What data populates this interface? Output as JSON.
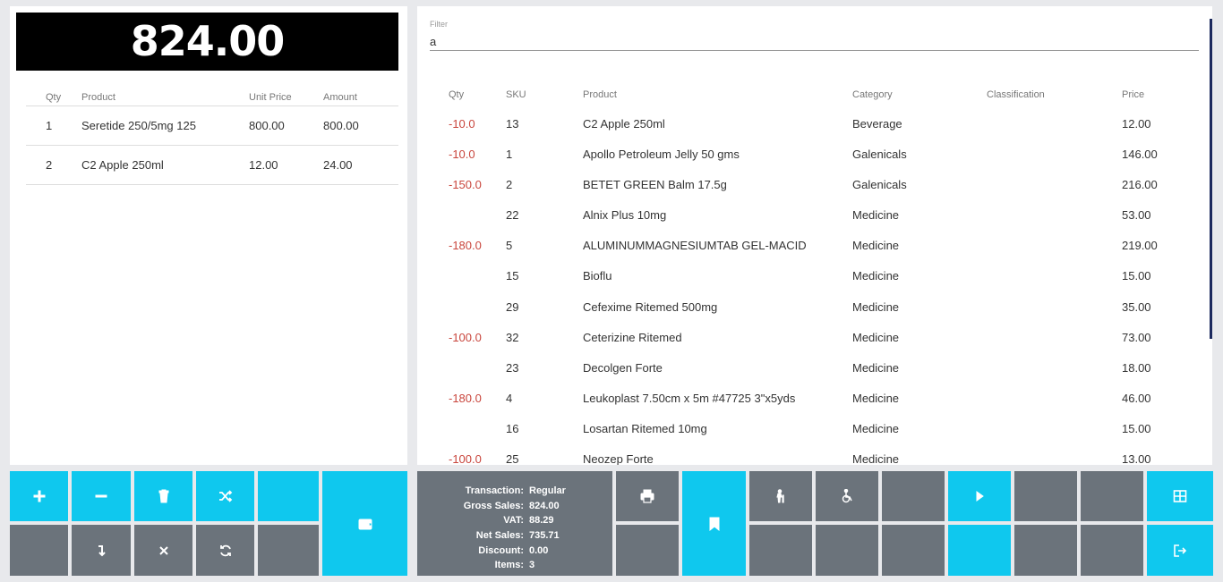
{
  "total_display": "824.00",
  "cart": {
    "headers": {
      "qty": "Qty",
      "product": "Product",
      "unit_price": "Unit Price",
      "amount": "Amount"
    },
    "rows": [
      {
        "qty": "1",
        "product": "Seretide 250/5mg 125",
        "unit_price": "800.00",
        "amount": "800.00"
      },
      {
        "qty": "2",
        "product": "C2 Apple 250ml",
        "unit_price": "12.00",
        "amount": "24.00"
      }
    ]
  },
  "filter": {
    "label": "Filter",
    "value": "a"
  },
  "products": {
    "headers": {
      "qty": "Qty",
      "sku": "SKU",
      "product": "Product",
      "category": "Category",
      "classification": "Classification",
      "price": "Price"
    },
    "rows": [
      {
        "qty": "-10.0",
        "sku": "13",
        "product": "C2 Apple 250ml",
        "category": "Beverage",
        "classification": "",
        "price": "12.00"
      },
      {
        "qty": "-10.0",
        "sku": "1",
        "product": "Apollo Petroleum Jelly 50 gms",
        "category": "Galenicals",
        "classification": "",
        "price": "146.00"
      },
      {
        "qty": "-150.0",
        "sku": "2",
        "product": "BETET GREEN Balm 17.5g",
        "category": "Galenicals",
        "classification": "",
        "price": "216.00"
      },
      {
        "qty": "",
        "sku": "22",
        "product": "Alnix Plus 10mg",
        "category": "Medicine",
        "classification": "",
        "price": "53.00"
      },
      {
        "qty": "-180.0",
        "sku": "5",
        "product": "ALUMINUMMAGNESIUMTAB GEL-MACID",
        "category": "Medicine",
        "classification": "",
        "price": "219.00"
      },
      {
        "qty": "",
        "sku": "15",
        "product": "Bioflu",
        "category": "Medicine",
        "classification": "",
        "price": "15.00"
      },
      {
        "qty": "",
        "sku": "29",
        "product": "Cefexime Ritemed 500mg",
        "category": "Medicine",
        "classification": "",
        "price": "35.00"
      },
      {
        "qty": "-100.0",
        "sku": "32",
        "product": "Ceterizine Ritemed",
        "category": "Medicine",
        "classification": "",
        "price": "73.00"
      },
      {
        "qty": "",
        "sku": "23",
        "product": "Decolgen Forte",
        "category": "Medicine",
        "classification": "",
        "price": "18.00"
      },
      {
        "qty": "-180.0",
        "sku": "4",
        "product": "Leukoplast 7.50cm x 5m #47725 3\"x5yds",
        "category": "Medicine",
        "classification": "",
        "price": "46.00"
      },
      {
        "qty": "",
        "sku": "16",
        "product": "Losartan Ritemed 10mg",
        "category": "Medicine",
        "classification": "",
        "price": "15.00"
      },
      {
        "qty": "-100.0",
        "sku": "25",
        "product": "Neozep Forte",
        "category": "Medicine",
        "classification": "",
        "price": "13.00"
      }
    ]
  },
  "summary": {
    "transaction_label": "Transaction:",
    "transaction": "Regular",
    "gross_label": "Gross Sales:",
    "gross": "824.00",
    "vat_label": "VAT:",
    "vat": "88.29",
    "net_label": "Net Sales:",
    "net": "735.71",
    "discount_label": "Discount:",
    "discount": "0.00",
    "items_label": "Items:",
    "items": "3"
  },
  "icons": {
    "add": "plus-icon",
    "minus": "minus-icon",
    "delete": "trash-icon",
    "shuffle": "shuffle-icon",
    "enter": "level-down-icon",
    "cancel": "close-icon",
    "refresh": "refresh-icon",
    "wallet": "wallet-icon",
    "print": "print-icon",
    "bookmark": "bookmark-icon",
    "senior": "elderly-icon",
    "pwd": "wheelchair-icon",
    "play": "play-icon",
    "grid": "grid-icon",
    "logout": "logout-icon"
  },
  "colors": {
    "accent": "#0fc8ee",
    "button_grey": "#6b737b",
    "negative_qty": "#c9463d",
    "total_bg": "#000000"
  }
}
